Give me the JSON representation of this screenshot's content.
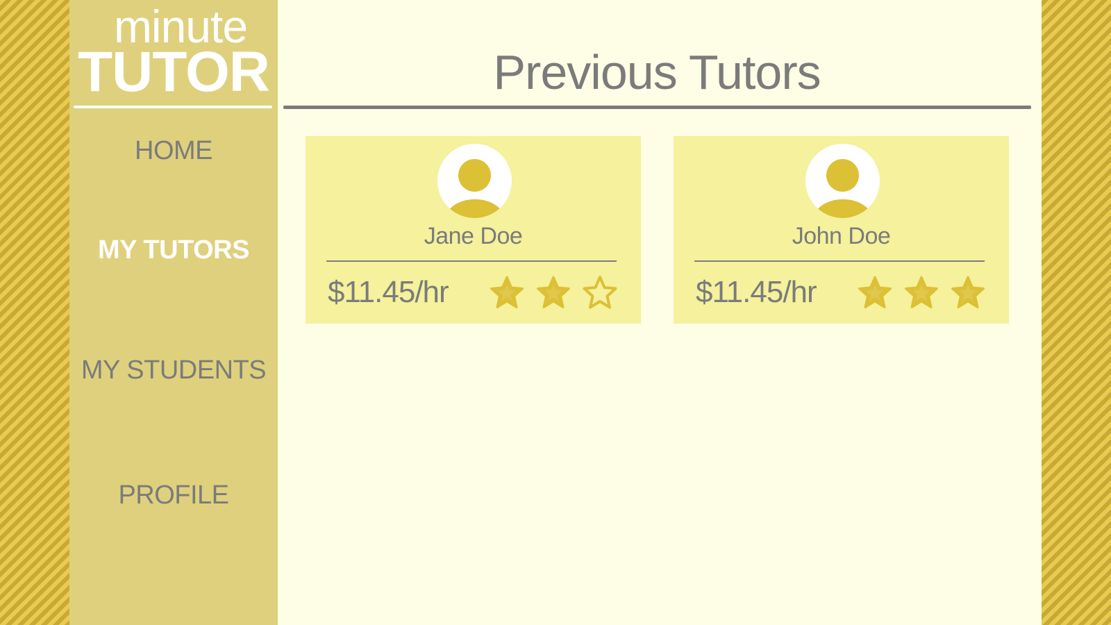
{
  "app": {
    "logo_top": "minute",
    "logo_bottom": "TUTOR"
  },
  "sidebar": {
    "items": [
      {
        "label": "HOME",
        "active": false
      },
      {
        "label": "MY TUTORS",
        "active": true
      },
      {
        "label": "MY STUDENTS",
        "active": false
      },
      {
        "label": "PROFILE",
        "active": false
      }
    ]
  },
  "main": {
    "title": "Previous Tutors"
  },
  "tutors": [
    {
      "name": "Jane Doe",
      "rate": "$11.45/hr",
      "rating": 2,
      "max_rating": 3
    },
    {
      "name": "John Doe",
      "rate": "$11.45/hr",
      "rating": 3,
      "max_rating": 3
    }
  ],
  "colors": {
    "accent": "#dcc035",
    "sidebar": "#dfd07d",
    "card": "#f5f19c",
    "text": "#7b7b7b",
    "background": "#fefee6"
  },
  "icons": {
    "avatar": "user-avatar-icon",
    "star_filled": "star-filled-icon",
    "star_empty": "star-outline-icon"
  }
}
